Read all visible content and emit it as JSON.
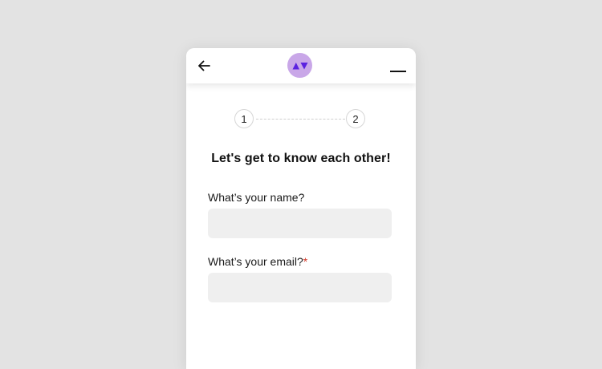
{
  "header": {
    "back_icon": "arrow-left-icon",
    "logo_icon": "triangles-logo-icon",
    "menu_icon": "menu-icon",
    "logo_bg_color": "#c9a7e8",
    "logo_color": "#5b21e0"
  },
  "steps": [
    "1",
    "2"
  ],
  "form": {
    "heading": "Let's get to know each other!",
    "name_label": "What’s your name?",
    "name_value": "",
    "name_placeholder": "",
    "email_label": "What’s your email?",
    "email_required_mark": "*",
    "email_value": "",
    "email_placeholder": ""
  }
}
